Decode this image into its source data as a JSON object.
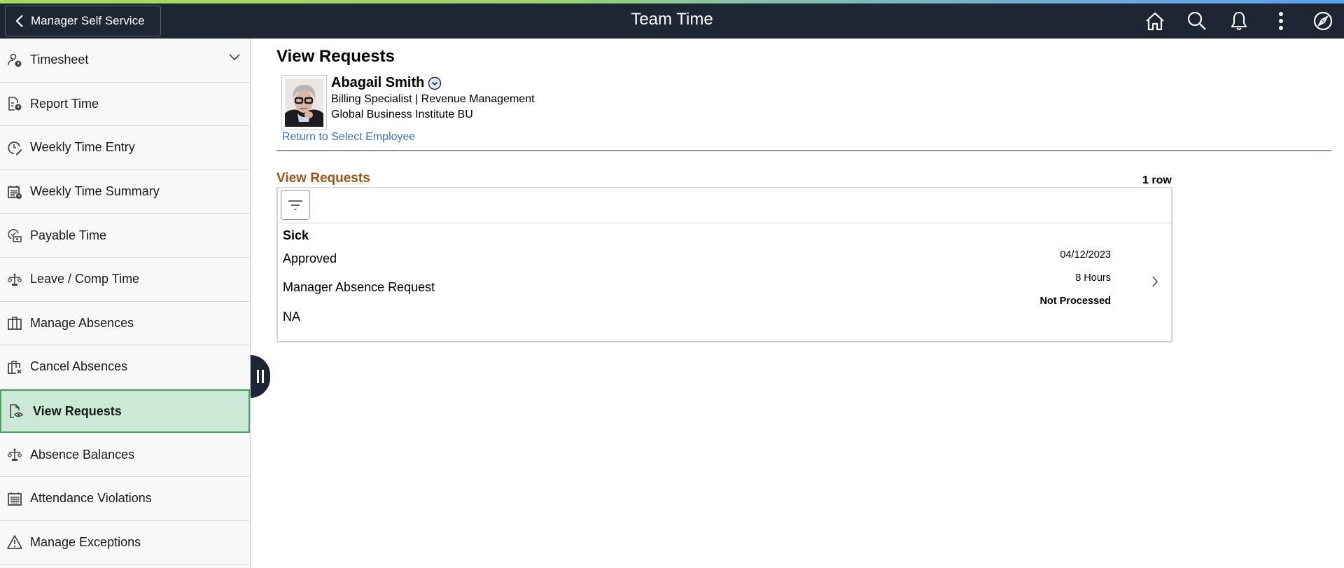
{
  "header": {
    "back_label": "Manager Self Service",
    "title": "Team Time",
    "icons": [
      "home-icon",
      "search-icon",
      "notifications-icon",
      "more-actions-icon",
      "navigator-compass-icon"
    ]
  },
  "sidebar": {
    "items": [
      {
        "label": "Timesheet",
        "icon": "person-clock-icon",
        "expandable": true,
        "active": false
      },
      {
        "label": "Report Time",
        "icon": "document-clock-icon",
        "active": false
      },
      {
        "label": "Weekly Time Entry",
        "icon": "clock-pencil-icon",
        "active": false
      },
      {
        "label": "Weekly Time Summary",
        "icon": "calendar-clock-icon",
        "active": false
      },
      {
        "label": "Payable Time",
        "icon": "clock-money-icon",
        "active": false
      },
      {
        "label": "Leave / Comp Time",
        "icon": "balance-scale-icon",
        "active": false
      },
      {
        "label": "Manage Absences",
        "icon": "briefcase-icon",
        "active": false
      },
      {
        "label": "Cancel Absences",
        "icon": "briefcase-cancel-icon",
        "active": false
      },
      {
        "label": "View Requests",
        "icon": "document-eye-icon",
        "active": true
      },
      {
        "label": "Absence Balances",
        "icon": "balance-scale-icon",
        "active": false
      },
      {
        "label": "Attendance Violations",
        "icon": "calendar-icon",
        "active": false
      },
      {
        "label": "Manage Exceptions",
        "icon": "warning-triangle-icon",
        "active": false
      }
    ]
  },
  "main": {
    "page_title": "View Requests",
    "employee": {
      "name": "Abagail Smith",
      "title_dept": "Billing Specialist | Revenue Management",
      "business_unit": "Global Business Institute BU",
      "return_link": "Return to Select Employee"
    },
    "grid": {
      "title": "View Requests",
      "row_count": "1 row",
      "rows": [
        {
          "type": "Sick",
          "status": "Approved",
          "source": "Manager Absence Request",
          "extra": "NA",
          "date": "04/12/2023",
          "duration": "8 Hours",
          "processing": "Not Processed"
        }
      ]
    }
  },
  "colors": {
    "header_bg": "#1f2633",
    "active_item_bg": "#cce8d6",
    "active_item_border": "#4f9e62",
    "grid_title": "#9c5419",
    "link": "#3c71c9"
  }
}
